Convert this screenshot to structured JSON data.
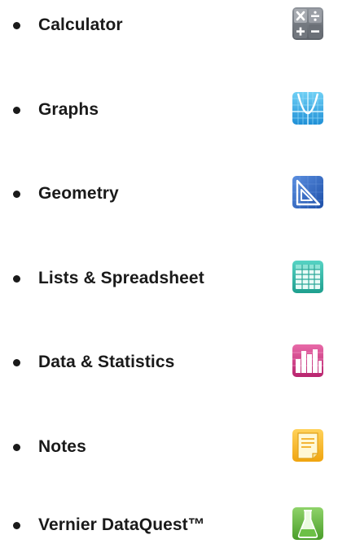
{
  "apps": [
    {
      "label": "Calculator",
      "icon": "calculator-icon"
    },
    {
      "label": "Graphs",
      "icon": "graphs-icon"
    },
    {
      "label": "Geometry",
      "icon": "geometry-icon"
    },
    {
      "label": "Lists & Spreadsheet",
      "icon": "lists-spreadsheet-icon"
    },
    {
      "label": "Data & Statistics",
      "icon": "data-statistics-icon"
    },
    {
      "label": "Notes",
      "icon": "notes-icon"
    },
    {
      "label": "Vernier DataQuest™",
      "icon": "vernier-dataquest-icon"
    }
  ]
}
